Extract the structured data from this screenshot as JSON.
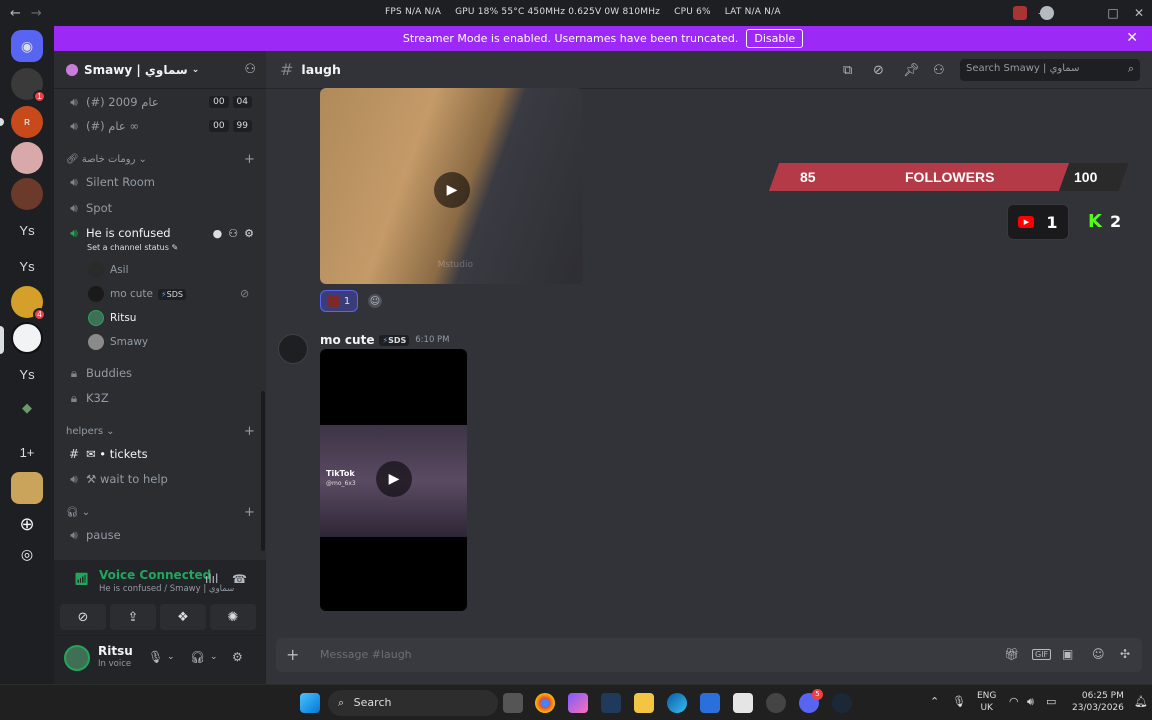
{
  "titlebar": {
    "window_title": "Smawy | سماوي",
    "perf": [
      "FPS N/A N/A",
      "GPU 18% 55°C 450MHz 0.625V 0W 810MHz",
      "CPU 6%",
      "LAT N/A N/A"
    ]
  },
  "banner": {
    "text": "Streamer Mode is enabled. Usernames have been truncated.",
    "button": "Disable"
  },
  "rail": {
    "servers": [
      {
        "label": "Discord",
        "icon": "discord-icon"
      },
      {
        "label": "",
        "badge": "1"
      },
      {
        "label": "",
        "badge": ""
      },
      {
        "label": "",
        "badge": ""
      },
      {
        "label": "",
        "badge": ""
      },
      {
        "label": "Ys"
      },
      {
        "label": "Ys"
      },
      {
        "label": "",
        "badge": "4"
      },
      {
        "label": "",
        "badge": ""
      },
      {
        "label": "Ys"
      },
      {
        "label": ""
      },
      {
        "label": "1+"
      },
      {
        "label": ""
      }
    ]
  },
  "guild": {
    "name": "Smawy | سماوي"
  },
  "channels": {
    "top": [
      {
        "name": "(#) عام 2009",
        "tags": [
          "00",
          "04"
        ]
      },
      {
        "name": "(#) عام ∞",
        "tags": [
          "00",
          "99"
        ]
      }
    ],
    "category_private": "رومات خاصة",
    "voice": [
      {
        "name": "Silent Room"
      },
      {
        "name": "Spot"
      },
      {
        "name": "He is confused",
        "status": "Set a channel status"
      }
    ],
    "voice_users": [
      {
        "name": "Asil"
      },
      {
        "name": "mo cute",
        "tag": "SDS"
      },
      {
        "name": "Ritsu"
      },
      {
        "name": "Smawy"
      }
    ],
    "locked": [
      {
        "name": "Buddies"
      },
      {
        "name": "K3Z"
      }
    ],
    "category_helpers": "helpers",
    "helpers": [
      {
        "name": "✉ • tickets"
      },
      {
        "name": "⚒ wait to help"
      }
    ],
    "category_audio": "",
    "audio": [
      {
        "name": "pause"
      }
    ]
  },
  "voice_panel": {
    "title": "Voice Connected",
    "subtitle": "He is confused / Smawy | سماوي"
  },
  "user": {
    "name": "Ritsu",
    "status": "In voice"
  },
  "chat": {
    "channel": "laugh",
    "search_placeholder": "Search Smawy | سماوي",
    "reaction_count": "1",
    "message": {
      "author": "mo cute",
      "tag": "SDS",
      "time": "6:10 PM"
    },
    "video1_watermark": "Mstudio",
    "video2_label": "TikTok",
    "video2_handle": "@mo_6x3",
    "composer_placeholder": "Message #laugh"
  },
  "stream_overlay": {
    "current": "85",
    "label": "FOLLOWERS",
    "goal": "100",
    "goal_progress": 0.85,
    "youtube_count": "1",
    "kick_count": "2",
    "kick_logo": "K"
  },
  "taskbar": {
    "search": "Search",
    "lang_top": "ENG",
    "lang_bottom": "UK",
    "time": "06:25 PM",
    "date": "23/03/2026",
    "discord_badge": "5"
  },
  "colors": {
    "banner": "#9c29f5",
    "voice_green": "#23a55a",
    "overlay_red": "#b43a48",
    "kick_green": "#53fc18"
  }
}
